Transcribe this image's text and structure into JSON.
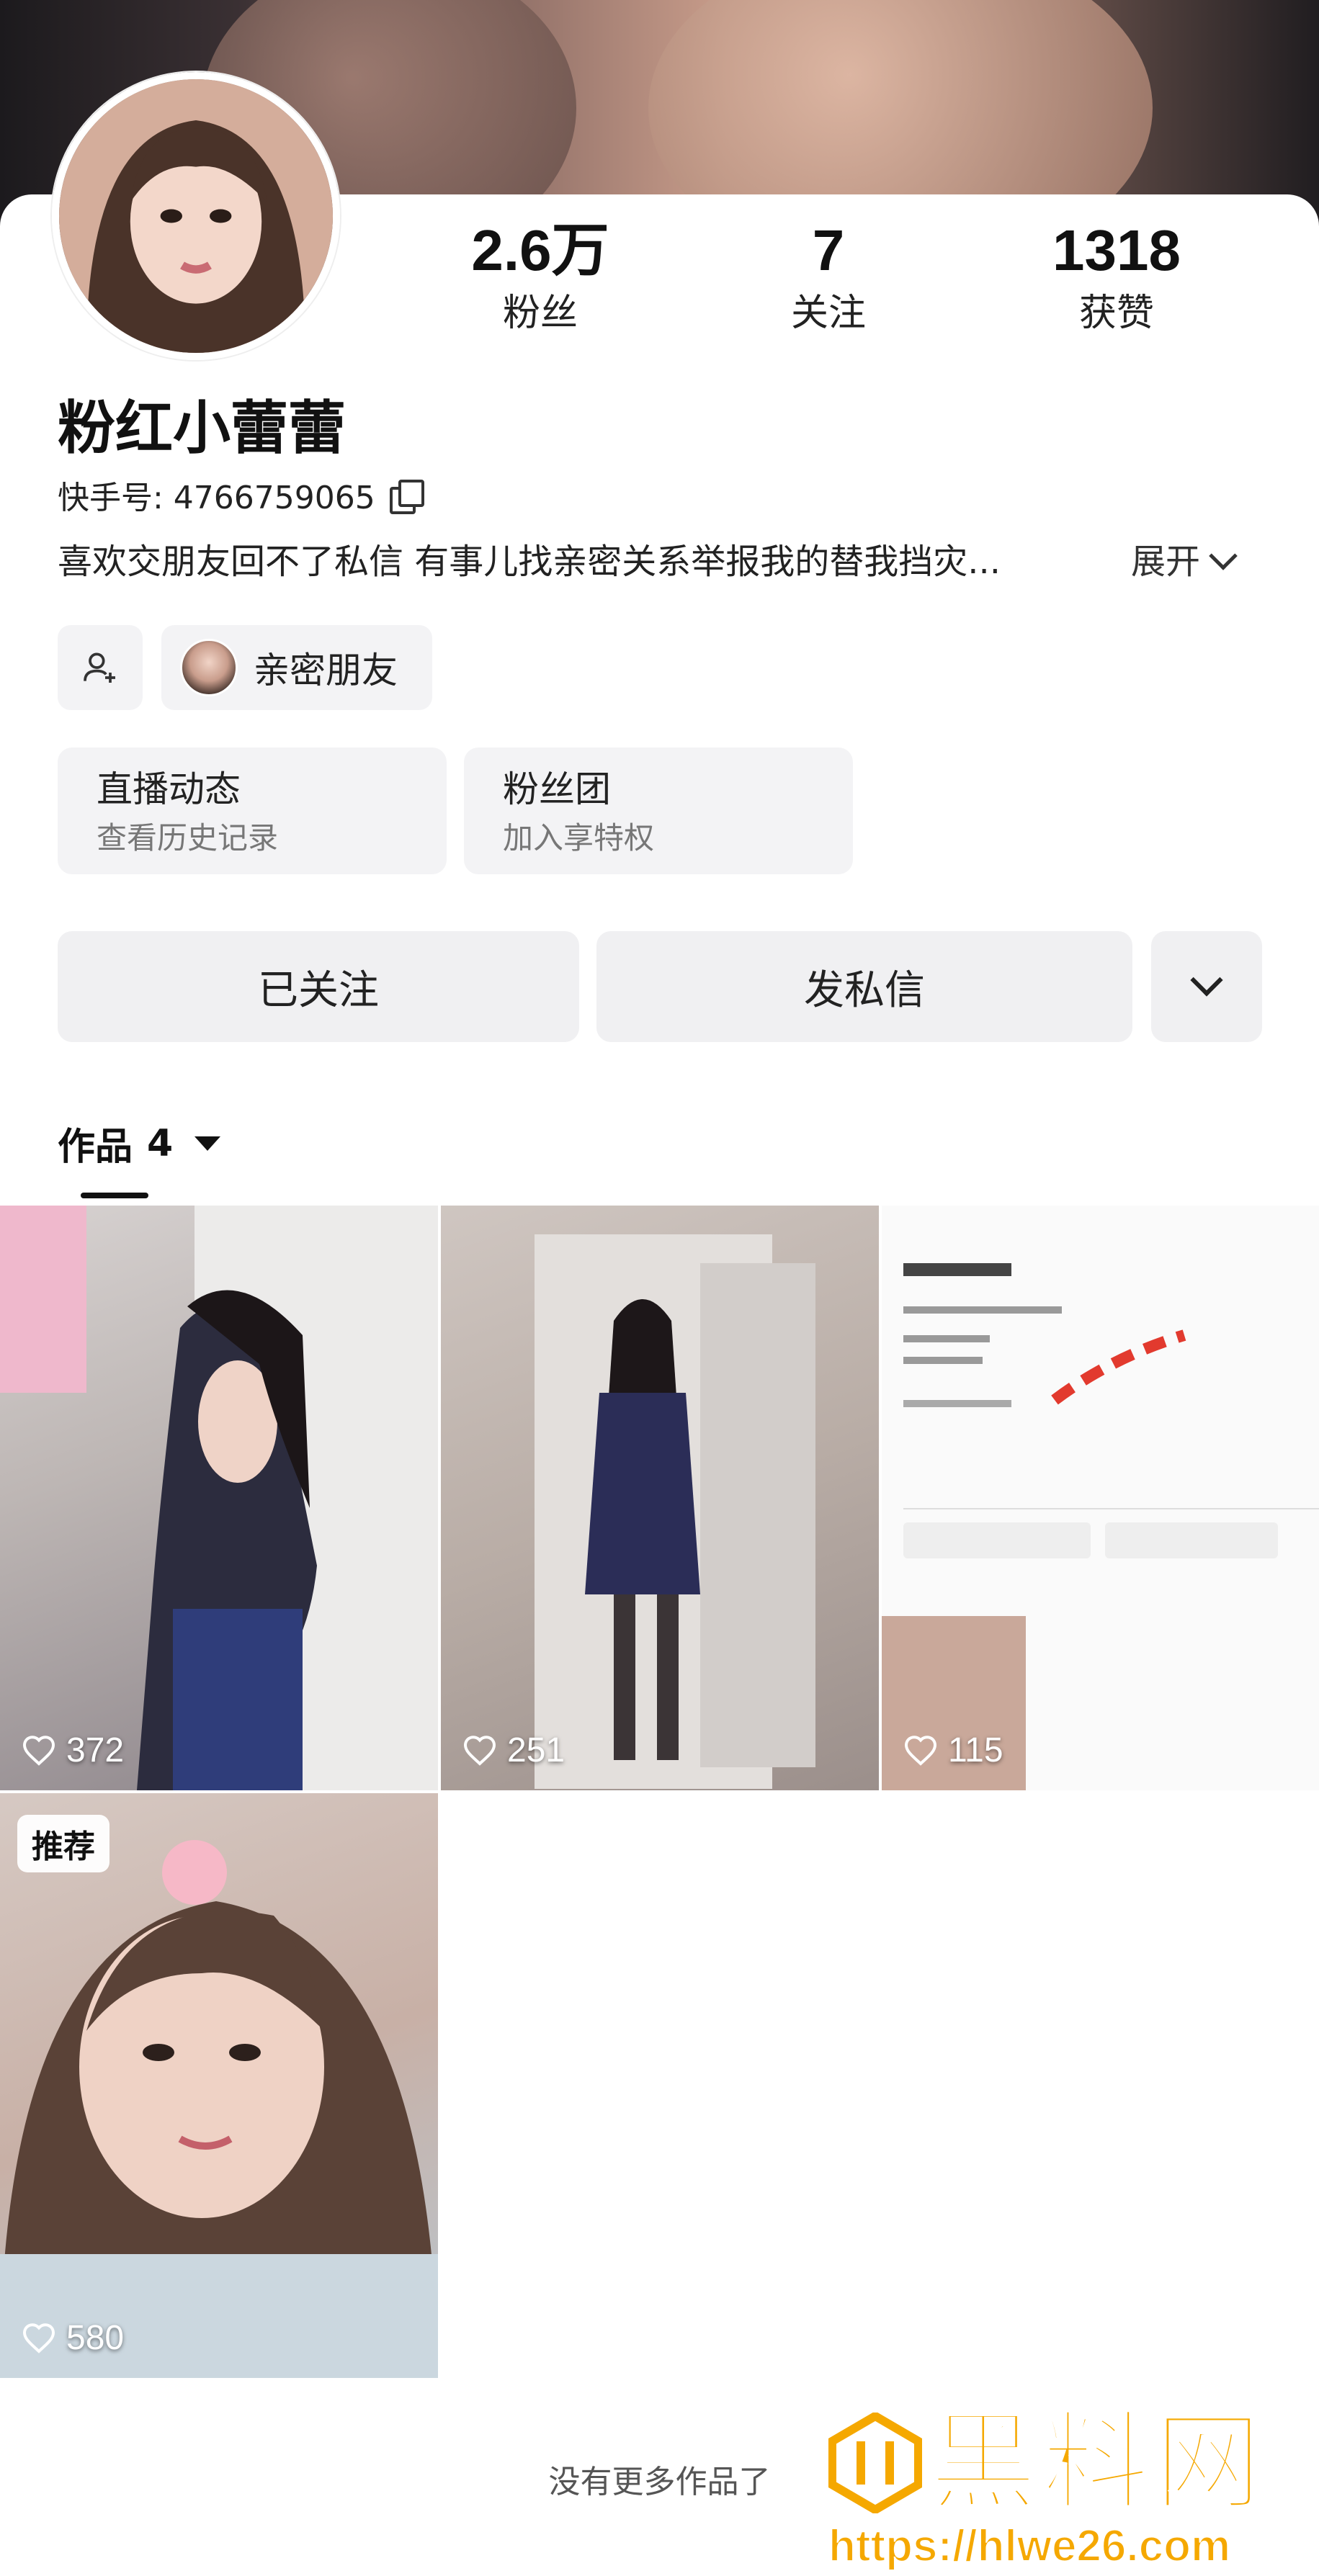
{
  "profile": {
    "name": "粉红小蕾蕾",
    "uid_label": "快手号: 4766759065",
    "bio": "喜欢交朋友回不了私信 有事儿找亲密关系举报我的替我挡灾...",
    "expand_label": "展开"
  },
  "stats": [
    {
      "value": "2.6万",
      "label": "粉丝"
    },
    {
      "value": "7",
      "label": "关注"
    },
    {
      "value": "1318",
      "label": "获赞"
    }
  ],
  "close_friend_label": "亲密朋友",
  "cards": [
    {
      "title": "直播动态",
      "subtitle": "查看历史记录"
    },
    {
      "title": "粉丝团",
      "subtitle": "加入享特权"
    }
  ],
  "actions": {
    "follow": "已关注",
    "message": "发私信"
  },
  "tab": {
    "label": "作品",
    "count": "4"
  },
  "works": [
    {
      "likes": "372"
    },
    {
      "likes": "251"
    },
    {
      "likes": "115"
    },
    {
      "likes": "580",
      "tag": "推荐"
    }
  ],
  "footer": "没有更多作品了",
  "watermark": {
    "text": "黑料网",
    "url": "https://hlwe26.com"
  },
  "colors": {
    "watermark": "#f5a800",
    "button_bg": "#f0f0f2"
  }
}
